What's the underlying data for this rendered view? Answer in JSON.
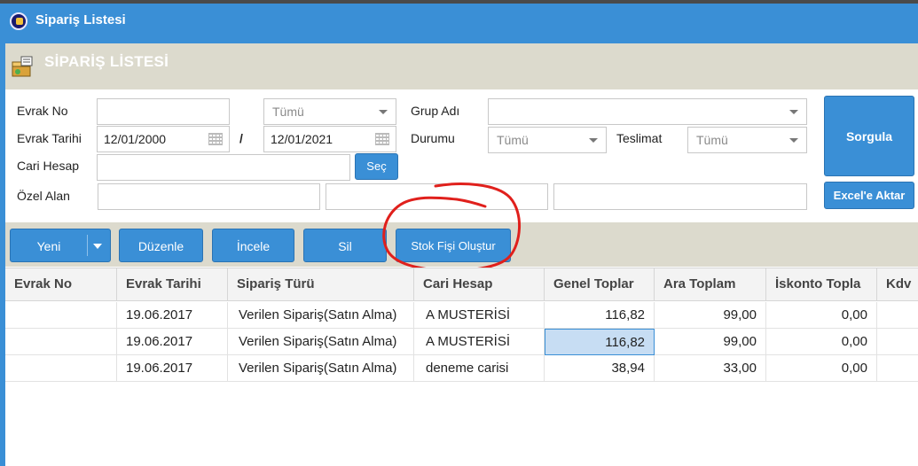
{
  "window": {
    "title": "Sipariş Listesi"
  },
  "page": {
    "title": "SİPARİŞ LİSTESİ"
  },
  "filters": {
    "evrak_no_label": "Evrak No",
    "evrak_no_value": "",
    "type_select": "Tümü",
    "grup_adi_label": "Grup Adı",
    "grup_adi_value": "",
    "evrak_tarihi_label": "Evrak Tarihi",
    "date_from": "12/01/2000",
    "date_sep": "/",
    "date_to": "12/01/2021",
    "durumu_label": "Durumu",
    "durumu_value": "Tümü",
    "teslimat_label": "Teslimat",
    "teslimat_value": "Tümü",
    "cari_hesap_label": "Cari Hesap",
    "cari_hesap_value": "",
    "sec_button": "Seç",
    "ozel_alan_label": "Özel Alan",
    "sorgula_button": "Sorgula",
    "excel_button": "Excel'e Aktar"
  },
  "toolbar": {
    "yeni": "Yeni",
    "duzenle": "Düzenle",
    "incele": "İncele",
    "sil": "Sil",
    "stok_fisi": "Stok Fişi Oluştur"
  },
  "grid": {
    "columns": [
      "Evrak No",
      "Evrak Tarihi",
      "Sipariş Türü",
      "Cari Hesap",
      "Genel Toplar",
      "Ara Toplam",
      "İskonto Topla",
      "Kdv"
    ],
    "rows": [
      [
        "",
        "19.06.2017",
        "Verilen Sipariş(Satın Alma)",
        "A MUSTERİSİ",
        "116,82",
        "99,00",
        "0,00",
        ""
      ],
      [
        "",
        "19.06.2017",
        "Verilen Sipariş(Satın Alma)",
        "A MUSTERİSİ",
        "116,82",
        "99,00",
        "0,00",
        ""
      ],
      [
        "",
        "19.06.2017",
        "Verilen Sipariş(Satın Alma)",
        "deneme carisi",
        "38,94",
        "33,00",
        "0,00",
        ""
      ]
    ]
  },
  "colors": {
    "accent": "#3a8fd6",
    "band": "#dcdacd",
    "annotation": "#e0201c"
  }
}
